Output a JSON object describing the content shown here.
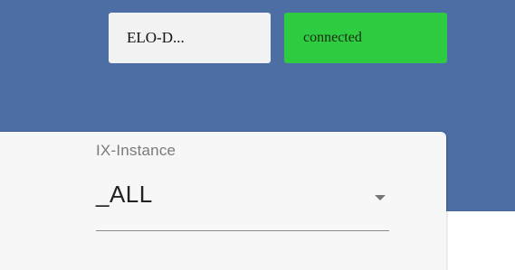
{
  "header": {
    "system_name": "ELO-D...",
    "status": "connected",
    "colors": {
      "background": "#4c6ea4",
      "status_ok": "#2ecc40",
      "chip": "#f2f2f2"
    }
  },
  "instance_select": {
    "label": "IX-Instance",
    "value": "_ALL",
    "icon": "chevron-down-icon"
  }
}
